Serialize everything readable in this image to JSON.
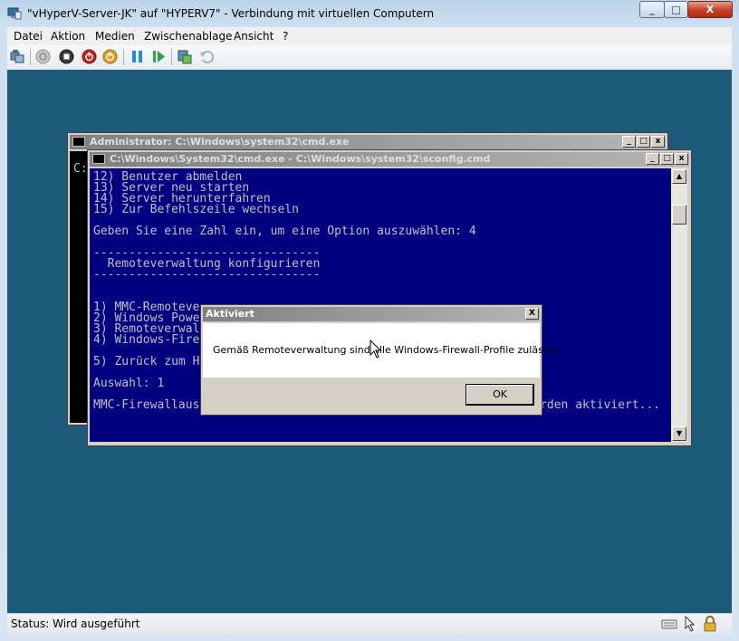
{
  "window": {
    "title": "\"vHyperV-Server-JK\" auf \"HYPERV7\" - Verbindung mit virtuellen Computern",
    "minimize_glyph": "_",
    "maximize_glyph": "□",
    "close_glyph": "X"
  },
  "menu": {
    "items": [
      "Datei",
      "Aktion",
      "Medien",
      "Zwischenablage",
      "Ansicht",
      "?"
    ]
  },
  "toolbar": {
    "icons": [
      "ctrl-alt-del-icon",
      "start-icon",
      "turn-off-icon",
      "shutdown-icon",
      "save-icon",
      "pause-icon",
      "resume-icon",
      "snapshot-icon",
      "revert-icon"
    ]
  },
  "vm": {
    "back_window": {
      "title": "Administrator: C:\\Windows\\system32\\cmd.exe",
      "prompt": "C:"
    },
    "front_window": {
      "title": "C:\\Windows\\System32\\cmd.exe - C:\\Windows\\system32\\sconfig.cmd",
      "lines": [
        "12) Benutzer abmelden",
        "13) Server neu starten",
        "14) Server herunterfahren",
        "15) Zur Befehlszeile wechseln",
        "",
        "Geben Sie eine Zahl ein, um eine Option auszuwählen: 4",
        "",
        "--------------------------------",
        "  Remoteverwaltung konfigurieren",
        "--------------------------------",
        "",
        "",
        "1) MMC-Remoteve",
        "2) Windows Powe",
        "3) Remoteverwal",
        "4) Windows-Fire",
        "",
        "5) Zurück zum H",
        "",
        "Auswahl: 1",
        "",
        "MMC-Firewallausnahmen u. a. Dienst für virtuelle Datenträger werden aktiviert..."
      ]
    },
    "dialog": {
      "title": "Aktiviert",
      "message": "Gemäß Remoteverwaltung sind alle Windows-Firewall-Profile zulässig.",
      "ok_label": "OK",
      "close_glyph": "X"
    }
  },
  "status": {
    "text": "Status: Wird ausgeführt"
  },
  "colors": {
    "vm_background": "#1d5a79",
    "console_background": "#000080",
    "console_text": "#c0c0c0"
  }
}
